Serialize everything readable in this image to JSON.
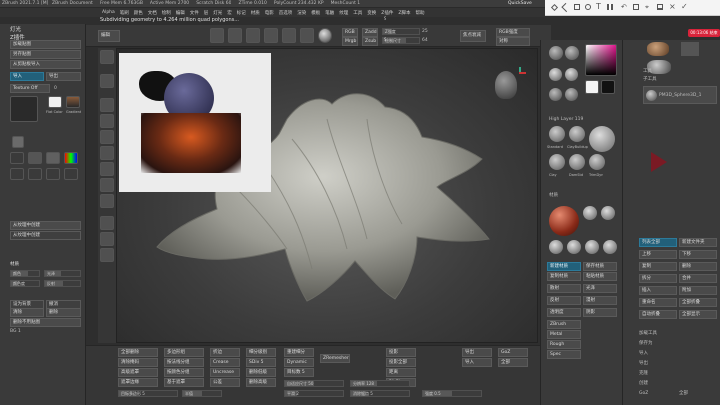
{
  "topbar": {
    "app": "ZBrush 2021.7.1 [M]",
    "doc": "ZBrush Document",
    "items": [
      "Free Mem 6.763GB",
      "Active Mem 2700",
      "Scratch Disk 60",
      "ZTime 0.010",
      "PolyCount 234.432 KP",
      "MeshCount 1"
    ],
    "quicksave": "QuickSave"
  },
  "menu": [
    "Alpha",
    "笔刷",
    "颜色",
    "文档",
    "绘制",
    "编辑",
    "文件",
    "层",
    "灯光",
    "宏",
    "标记",
    "材质",
    "电影",
    "首选项",
    "渲染",
    "模板",
    "笔触",
    "纹理",
    "工具",
    "变换",
    "Z插件",
    "Z脚本",
    "帮助"
  ],
  "status": "Subdividing geometry to 4.264 million quad polygons...",
  "snip": {
    "time": "00:13:06 结束"
  },
  "left": {
    "title": "灯光",
    "sub": "Z插件",
    "tool": "纹理",
    "b1": "加载贴图",
    "b2": "另存贴图",
    "b3": "从剪贴板导入",
    "b4": "导入",
    "b5": "导出",
    "tex_off": "Texture Off",
    "tex_val": "0",
    "flat": "Flat Color",
    "grad": "Gradient",
    "b6": "从纹理中创建",
    "b7": "从纹理中创建",
    "hdr2": "材质",
    "set": "颜色",
    "s1": "光泽",
    "s2": "颜色度",
    "s3": "反射",
    "b8": "设为背景",
    "b9": "撤消",
    "b10": "清除",
    "b11": "删除",
    "b12": "删除不用贴图"
  },
  "toolbar": {
    "edit": "编辑",
    "draw": "绘制",
    "move": "移动",
    "scale": "缩放",
    "rotate": "旋转",
    "rgb": "RGB",
    "mrgb": "Mrgb",
    "zadd": "Zadd",
    "zsub": "Zsub",
    "zint": "Z强度",
    "rgbint": "RGB强度",
    "focal": "焦点衰减",
    "drawsize": "绘制尺寸",
    "dynamic": "Dynamic",
    "val1": "64",
    "val2": "25",
    "persp": "Select Camera",
    "floor": "Floor",
    "sym": "对称"
  },
  "vleft": [
    "Brush",
    "Zoom",
    "Persp",
    "Floor",
    "Local",
    "Frame",
    "Move",
    "Scale",
    "Rotate",
    "Transp",
    "Solo",
    "Xpose"
  ],
  "right": {
    "lightbox": "灯箱",
    "brushes": "笔刷",
    "stroke": "Dots",
    "alpha": "Alpha Off",
    "tex": "Texture Off",
    "mat_hi": "MatCap Gray",
    "mat_lo": "SkinShade4",
    "brush_row1": [
      "Standard",
      "ClayBuildup",
      "Move",
      "hPolish"
    ],
    "brush_row2": [
      "Clay",
      "DamStd",
      "TrimDyn",
      "Smooth"
    ],
    "hdr": "High Layer 119",
    "matlabel": "材质",
    "mats": [
      "BasicMaterial",
      "Chrome",
      "MatCap Red",
      "SkinShade"
    ],
    "controls": [
      "新建材质",
      "保存材质",
      "复制材质",
      "粘贴材质"
    ],
    "props": [
      "散射",
      "光泽",
      "反射",
      "漫射",
      "透明度",
      "阴影"
    ],
    "labels": [
      "ZBrush",
      "Metal",
      "Rough",
      "Spec",
      "Ambient",
      "Blur",
      "Z强度",
      "Noise",
      "混合"
    ]
  },
  "farright": {
    "tool": "工具",
    "subtool": "子工具",
    "name": "PM3D_Sphere3D_1",
    "list": [
      "PM3D_Sphere3D_1"
    ],
    "btns": [
      "列表全部",
      "新建文件夹",
      "上移",
      "下移",
      "复制",
      "删除",
      "拆分",
      "合并",
      "插入",
      "附加",
      "重命名",
      "全部折叠",
      "自动折叠",
      "全部显示"
    ],
    "tool_labels": [
      "加载工具",
      "保存为",
      "导入",
      "导出",
      "克隆",
      "创建",
      "GoZ",
      "全部",
      "可见",
      "R"
    ]
  },
  "bottom": {
    "cols": [
      [
        "全部删除",
        "清除掩码",
        "高级遮罩",
        "遮罩边缘"
      ],
      [
        "多边形组",
        "按法线分组",
        "按颜色分组",
        "基于遮罩"
      ],
      [
        "折边",
        "Crease",
        "Uncrease",
        "公差"
      ],
      [
        "细分级别",
        "SDiv 5",
        "删除低级",
        "删除高级"
      ],
      [
        "重建细分",
        "Dynamic",
        "ZRemesher",
        "目标数 5"
      ],
      [
        "投影",
        "投影全部",
        "距离",
        "PA Blur"
      ],
      [
        "导出",
        "导入",
        "GoZ",
        "全部"
      ]
    ],
    "sl1": "目标多边形 5",
    "sl2": "半值",
    "sl3": "自适应尺寸 50",
    "sl4": "平滑 2",
    "sl5": "分辨率 128",
    "sl6": "消除锯齿 5",
    "sl7": "强度 0.5"
  }
}
